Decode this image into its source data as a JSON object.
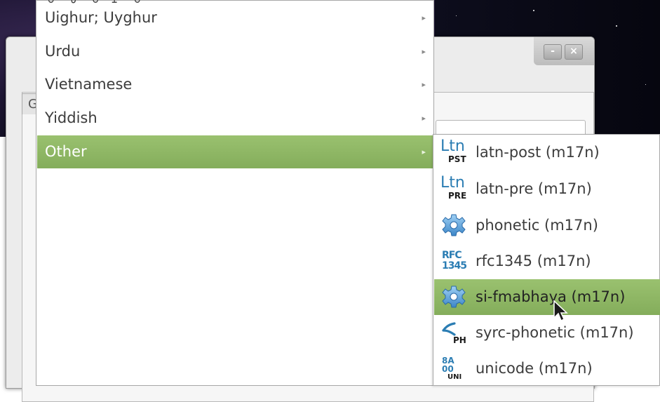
{
  "desktop": {
    "background_color": "#1d1533"
  },
  "background_window": {
    "minimize_label": "-",
    "close_label": "×",
    "tab_label": "G"
  },
  "menu": {
    "top_partial_text": "ꗳ ꖃ ꕦ ꖅ ꕦ",
    "items": [
      {
        "label": "Uighur; Uyghur",
        "has_submenu": true
      },
      {
        "label": "Urdu",
        "has_submenu": true
      },
      {
        "label": "Vietnamese",
        "has_submenu": true
      },
      {
        "label": "Yiddish",
        "has_submenu": true
      },
      {
        "label": "Other",
        "has_submenu": true,
        "active": true
      }
    ],
    "submenu_arrow": "▸",
    "highlight_color": "#8fb765"
  },
  "submenu": {
    "items": [
      {
        "label": "latn-post (m17n)",
        "icon": "ltn-pst-icon",
        "icon_big": "Ltn",
        "icon_small": "PST"
      },
      {
        "label": "latn-pre (m17n)",
        "icon": "ltn-pre-icon",
        "icon_big": "Ltn",
        "icon_small": "PRE"
      },
      {
        "label": "phonetic (m17n)",
        "icon": "gear-icon"
      },
      {
        "label": "rfc1345 (m17n)",
        "icon": "rfc1345-icon",
        "icon_line1": "RFC",
        "icon_line2": "1345"
      },
      {
        "label": "si-fmabhaya (m17n)",
        "icon": "gear-icon",
        "active": true
      },
      {
        "label": "syrc-phonetic (m17n)",
        "icon": "syrc-ph-icon",
        "icon_small": "PH"
      },
      {
        "label": "unicode (m17n)",
        "icon": "unicode-icon",
        "icon_line1": "8A",
        "icon_line2": "00",
        "icon_small": "UNI"
      }
    ]
  }
}
